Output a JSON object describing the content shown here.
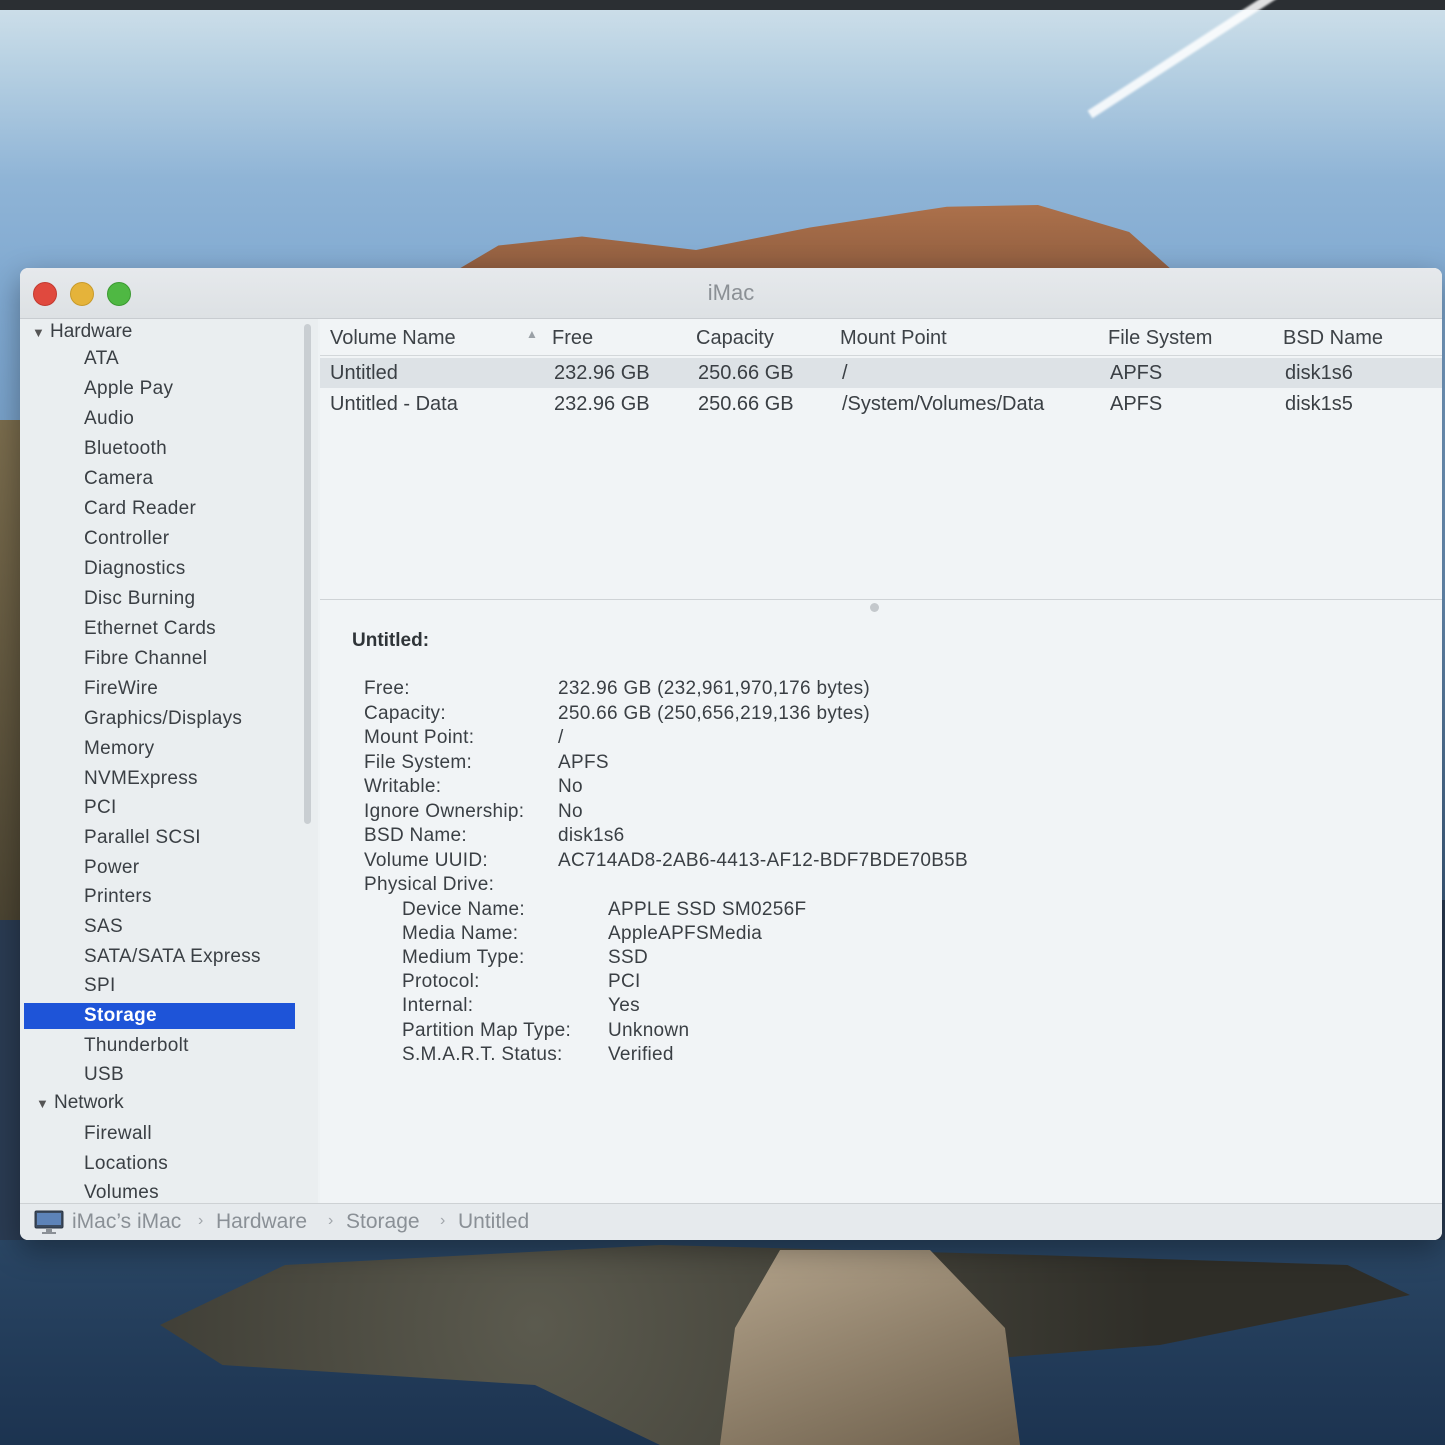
{
  "window": {
    "title": "iMac"
  },
  "sidebar": {
    "hardware": {
      "label": "Hardware",
      "items": [
        "ATA",
        "Apple Pay",
        "Audio",
        "Bluetooth",
        "Camera",
        "Card Reader",
        "Controller",
        "Diagnostics",
        "Disc Burning",
        "Ethernet Cards",
        "Fibre Channel",
        "FireWire",
        "Graphics/Displays",
        "Memory",
        "NVMExpress",
        "PCI",
        "Parallel SCSI",
        "Power",
        "Printers",
        "SAS",
        "SATA/SATA Express",
        "SPI",
        "Storage",
        "Thunderbolt",
        "USB"
      ],
      "selected": "Storage"
    },
    "network": {
      "label": "Network",
      "items": [
        "Firewall",
        "Locations",
        "Volumes"
      ]
    }
  },
  "table": {
    "columns": [
      "Volume Name",
      "Free",
      "Capacity",
      "Mount Point",
      "File System",
      "BSD Name"
    ],
    "rows": [
      [
        "Untitled",
        "232.96 GB",
        "250.66 GB",
        "/",
        "APFS",
        "disk1s6"
      ],
      [
        "Untitled - Data",
        "232.96 GB",
        "250.66 GB",
        "/System/Volumes/Data",
        "APFS",
        "disk1s5"
      ]
    ]
  },
  "detail": {
    "title": "Untitled:",
    "fields": [
      [
        "Free:",
        "232.96 GB (232,961,970,176 bytes)"
      ],
      [
        "Capacity:",
        "250.66 GB (250,656,219,136 bytes)"
      ],
      [
        "Mount Point:",
        "/"
      ],
      [
        "File System:",
        "APFS"
      ],
      [
        "Writable:",
        "No"
      ],
      [
        "Ignore Ownership:",
        "No"
      ],
      [
        "BSD Name:",
        "disk1s6"
      ],
      [
        "Volume UUID:",
        "AC714AD8-2AB6-4413-AF12-BDF7BDE70B5B"
      ]
    ],
    "physical_label": "Physical Drive:",
    "physical_fields": [
      [
        "Device Name:",
        "APPLE SSD SM0256F"
      ],
      [
        "Media Name:",
        "AppleAPFSMedia"
      ],
      [
        "Medium Type:",
        "SSD"
      ],
      [
        "Protocol:",
        "PCI"
      ],
      [
        "Internal:",
        "Yes"
      ],
      [
        "Partition Map Type:",
        "Unknown"
      ],
      [
        "S.M.A.R.T. Status:",
        "Verified"
      ]
    ]
  },
  "pathbar": {
    "crumbs": [
      "iMac’s iMac",
      "Hardware",
      "Storage",
      "Untitled"
    ],
    "separator": "›"
  },
  "colors": {
    "selection": "#1e54d8",
    "window_bg": "#eef2f4"
  },
  "icons": {
    "path_root": "imac-icon",
    "group_toggle": "disclosure-triangle-icon",
    "sort": "sort-indicator-icon"
  }
}
